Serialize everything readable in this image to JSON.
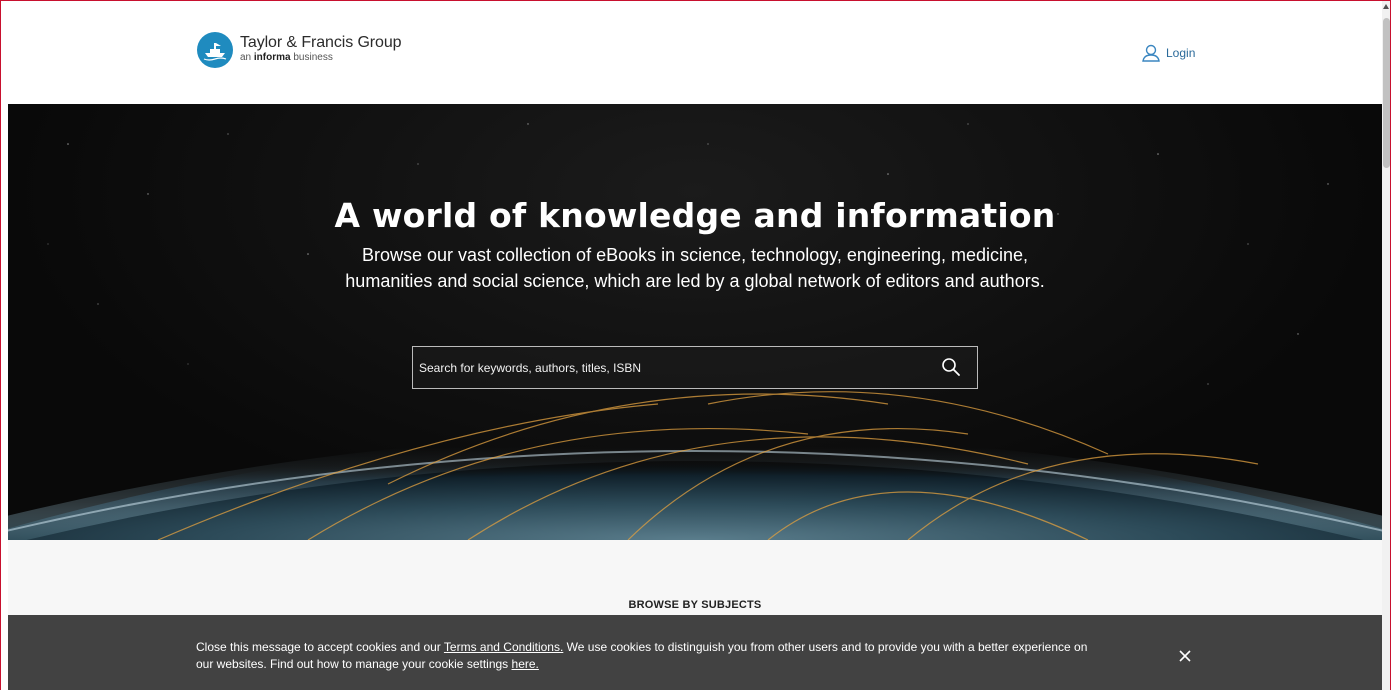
{
  "header": {
    "brand_name": "Taylor & Francis Group",
    "brand_tag_prefix": "an",
    "brand_tag_bold": "informa",
    "brand_tag_suffix": "business",
    "login_label": "Login"
  },
  "hero": {
    "title": "A world of knowledge and information",
    "subtitle": "Browse our vast collection of eBooks in science, technology, engineering, medicine, humanities and social science, which are led by a global network of editors and authors.",
    "search_placeholder": "Search for keywords, authors, titles, ISBN"
  },
  "subjects": {
    "heading": "BROWSE BY SUBJECTS"
  },
  "cookie_banner": {
    "text_before_link": "Close this message to accept cookies and our ",
    "terms_link": "Terms and Conditions.",
    "text_middle": " We use cookies to distinguish you from other users and to provide you with a better experience on our websites. Find out how to manage your cookie settings ",
    "here_link": "here."
  },
  "icons": {
    "logo": "taylor-francis-ship-logo",
    "login": "user-icon",
    "search": "search-icon",
    "close": "close-icon"
  },
  "colors": {
    "brand_blue": "#1f8bbf",
    "login_blue": "#2a6a9a",
    "cookie_bg": "#424242",
    "hero_bg": "#0a0a0a",
    "subjects_bg": "#f7f7f7"
  }
}
